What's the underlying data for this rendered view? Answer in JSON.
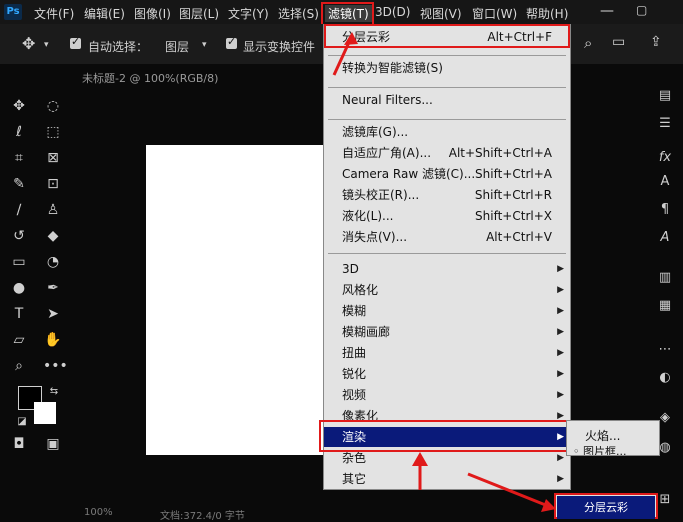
{
  "app": {
    "logo": "Ps"
  },
  "menubar": {
    "items": [
      {
        "label": "文件(F)"
      },
      {
        "label": "编辑(E)"
      },
      {
        "label": "图像(I)"
      },
      {
        "label": "图层(L)"
      },
      {
        "label": "文字(Y)"
      },
      {
        "label": "选择(S)"
      },
      {
        "label": "滤镜(T)"
      },
      {
        "label": "3D(D)"
      },
      {
        "label": "视图(V)"
      },
      {
        "label": "窗口(W)"
      },
      {
        "label": "帮助(H)"
      }
    ]
  },
  "options": {
    "auto_select_label": "自动选择：",
    "auto_select_value": "图层",
    "show_transform_label": "显示变换控件"
  },
  "document": {
    "tab_title": "未标题-2 @ 100%(RGB/8)"
  },
  "filter_menu": {
    "last_filter": {
      "label": "分层云彩",
      "shortcut": "Alt+Ctrl+F"
    },
    "convert_smart": {
      "label": "转换为智能滤镜(S)"
    },
    "neural": {
      "label": "Neural Filters..."
    },
    "group2": [
      {
        "label": "滤镜库(G)...",
        "shortcut": ""
      },
      {
        "label": "自适应广角(A)...",
        "shortcut": "Alt+Shift+Ctrl+A"
      },
      {
        "label": "Camera Raw 滤镜(C)...",
        "shortcut": "Shift+Ctrl+A"
      },
      {
        "label": "镜头校正(R)...",
        "shortcut": "Shift+Ctrl+R"
      },
      {
        "label": "液化(L)...",
        "shortcut": "Shift+Ctrl+X"
      },
      {
        "label": "消失点(V)...",
        "shortcut": "Alt+Ctrl+V"
      }
    ],
    "group3": [
      {
        "label": "3D"
      },
      {
        "label": "风格化"
      },
      {
        "label": "模糊"
      },
      {
        "label": "模糊画廊"
      },
      {
        "label": "扭曲"
      },
      {
        "label": "锐化"
      },
      {
        "label": "视频"
      },
      {
        "label": "像素化"
      },
      {
        "label": "渲染"
      },
      {
        "label": "杂色"
      },
      {
        "label": "其它"
      }
    ]
  },
  "render_submenu": {
    "items": [
      {
        "label": "火焰..."
      },
      {
        "label": "图片框..."
      }
    ]
  },
  "popup": {
    "label": "分层云彩"
  },
  "status": {
    "zoom": "100%",
    "doc": "文档:372.4/0 字节"
  },
  "colors": {
    "highlight": "#0a1a7a",
    "annotation_red": "#e01a1a",
    "menu_bg": "#e3e3e3"
  }
}
